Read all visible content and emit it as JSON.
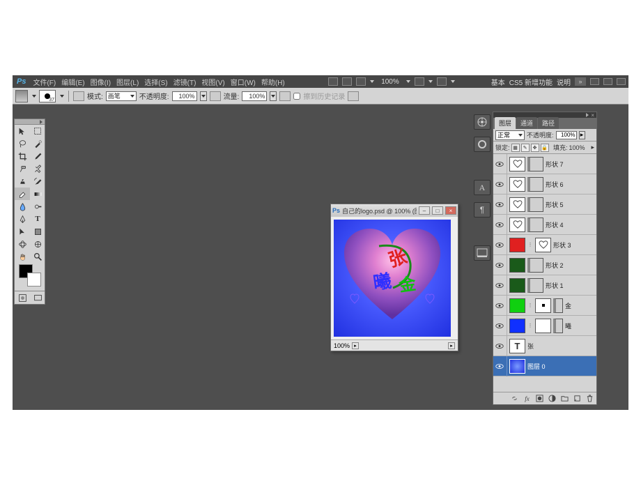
{
  "menubar": {
    "logo": "Ps",
    "items": [
      "文件(F)",
      "编辑(E)",
      "图像(I)",
      "图层(L)",
      "选择(S)",
      "滤镜(T)",
      "视图(V)",
      "窗口(W)",
      "帮助(H)"
    ],
    "zoom": "100%",
    "right_tags": [
      "基本",
      "CS5 新增功能",
      "说明"
    ]
  },
  "optionsbar": {
    "brush_size": "37",
    "mode_lbl": "模式:",
    "mode_val": "画笔",
    "opacity_lbl": "不透明度:",
    "opacity_val": "100%",
    "flow_lbl": "流量:",
    "flow_val": "100%",
    "history_lbl": "擦到历史记录"
  },
  "doc": {
    "title": "自己的logo.psd @ 100% (图...",
    "status_zoom": "100%"
  },
  "layers_panel": {
    "tabs": [
      "图层",
      "通道",
      "路径"
    ],
    "blend_mode": "正常",
    "opacity_lbl": "不透明度:",
    "opacity_val": "100%",
    "lock_lbl": "锁定:",
    "fill_lbl": "填充:",
    "fill_val": "100%",
    "layers": [
      {
        "name": "形状 7",
        "thumb": "white-heart",
        "mask": "vec"
      },
      {
        "name": "形状 6",
        "thumb": "white-heart",
        "mask": "vec"
      },
      {
        "name": "形状 5",
        "thumb": "white-heart",
        "mask": "vec"
      },
      {
        "name": "形状 4",
        "thumb": "white-heart",
        "mask": "vec"
      },
      {
        "name": "形状 3",
        "thumb": "red",
        "mask": "heart-white"
      },
      {
        "name": "形状 2",
        "thumb": "dkgreen",
        "mask": "vec"
      },
      {
        "name": "形状 1",
        "thumb": "dkgreen",
        "mask": "vec"
      },
      {
        "name": "金",
        "thumb": "green",
        "mask": "white",
        "extra_mask": true
      },
      {
        "name": "曦",
        "thumb": "blue",
        "mask": "white",
        "extra_mask": true
      },
      {
        "name": "张",
        "thumb": "type"
      },
      {
        "name": "图层 0",
        "thumb": "gradient-blue",
        "selected": true
      }
    ]
  }
}
